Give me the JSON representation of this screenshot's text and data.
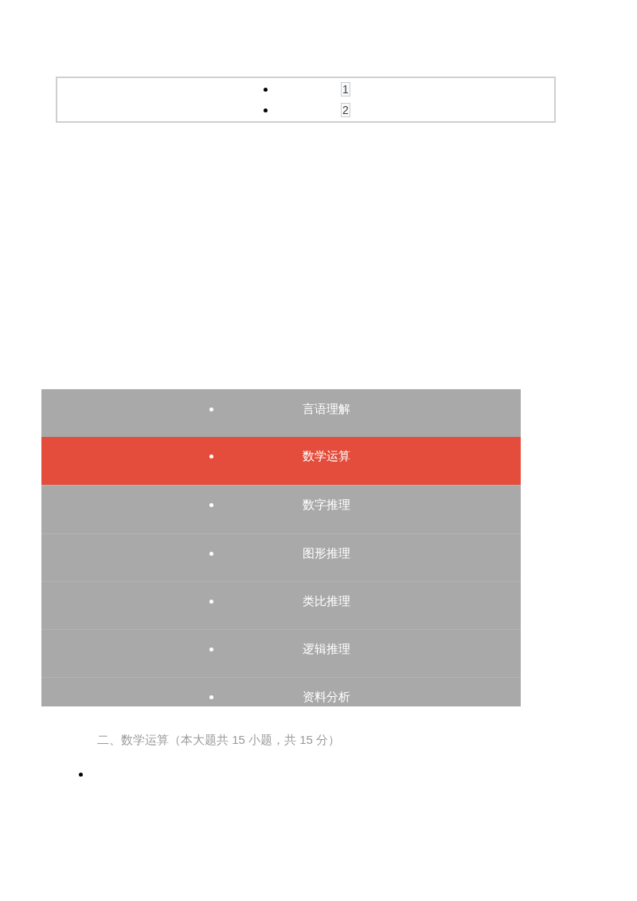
{
  "pagination": {
    "pages": [
      {
        "label": "1"
      },
      {
        "label": "2"
      }
    ]
  },
  "category_nav": {
    "items": [
      {
        "label": "言语理解",
        "selected": false
      },
      {
        "label": "数学运算",
        "selected": true
      },
      {
        "label": "数字推理",
        "selected": false
      },
      {
        "label": "图形推理",
        "selected": false
      },
      {
        "label": "类比推理",
        "selected": false
      },
      {
        "label": "逻辑推理",
        "selected": false
      },
      {
        "label": "资料分析",
        "selected": false
      }
    ]
  },
  "section_heading": "二、数学运算（本大题共 15 小题，共 15 分）"
}
